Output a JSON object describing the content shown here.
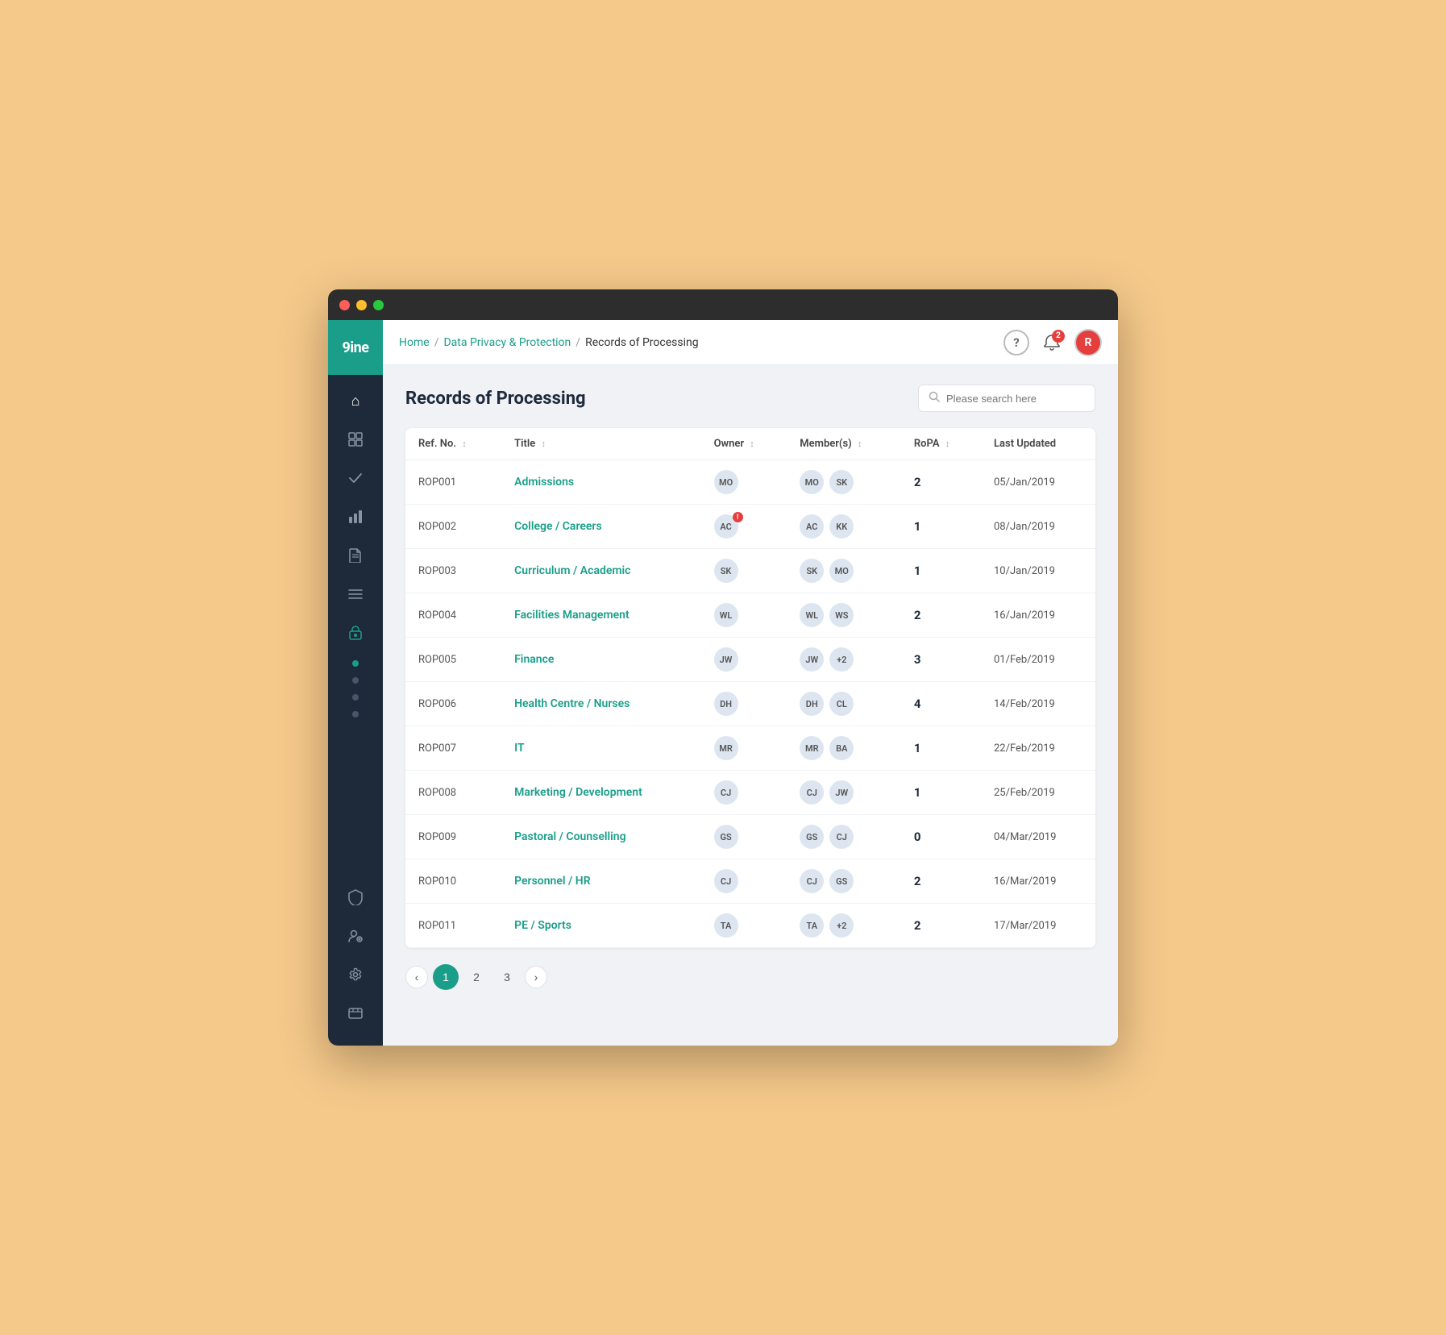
{
  "window": {
    "title": "Records of Processing"
  },
  "topnav": {
    "breadcrumb": {
      "home": "Home",
      "section": "Data Privacy & Protection",
      "current": "Records of Processing"
    },
    "notification_count": "2",
    "avatar_initials": "R"
  },
  "page": {
    "title": "Records of Processing",
    "search_placeholder": "Please search here"
  },
  "table": {
    "columns": [
      "Ref. No.",
      "Title",
      "Owner",
      "Member(s)",
      "RoPA",
      "Last Updated"
    ],
    "rows": [
      {
        "ref": "ROP001",
        "title": "Admissions",
        "owner": "MO",
        "members": [
          "MO",
          "SK"
        ],
        "extra_members": null,
        "ropa": "2",
        "date": "05/Jan/2019",
        "owner_warn": false
      },
      {
        "ref": "ROP002",
        "title": "College / Careers",
        "owner": "AC",
        "members": [
          "AC",
          "KK"
        ],
        "extra_members": null,
        "ropa": "1",
        "date": "08/Jan/2019",
        "owner_warn": true
      },
      {
        "ref": "ROP003",
        "title": "Curriculum / Academic",
        "owner": "SK",
        "members": [
          "SK",
          "MO"
        ],
        "extra_members": null,
        "ropa": "1",
        "date": "10/Jan/2019",
        "owner_warn": false
      },
      {
        "ref": "ROP004",
        "title": "Facilities Management",
        "owner": "WL",
        "members": [
          "WL",
          "WS"
        ],
        "extra_members": null,
        "ropa": "2",
        "date": "16/Jan/2019",
        "owner_warn": false
      },
      {
        "ref": "ROP005",
        "title": "Finance",
        "owner": "JW",
        "members": [
          "JW"
        ],
        "extra_members": "+2",
        "ropa": "3",
        "date": "01/Feb/2019",
        "owner_warn": false
      },
      {
        "ref": "ROP006",
        "title": "Health Centre / Nurses",
        "owner": "DH",
        "members": [
          "DH",
          "CL"
        ],
        "extra_members": null,
        "ropa": "4",
        "date": "14/Feb/2019",
        "owner_warn": false
      },
      {
        "ref": "ROP007",
        "title": "IT",
        "owner": "MR",
        "members": [
          "MR",
          "BA"
        ],
        "extra_members": null,
        "ropa": "1",
        "date": "22/Feb/2019",
        "owner_warn": false
      },
      {
        "ref": "ROP008",
        "title": "Marketing / Development",
        "owner": "CJ",
        "members": [
          "CJ",
          "JW"
        ],
        "extra_members": null,
        "ropa": "1",
        "date": "25/Feb/2019",
        "owner_warn": false
      },
      {
        "ref": "ROP009",
        "title": "Pastoral / Counselling",
        "owner": "GS",
        "members": [
          "GS",
          "CJ"
        ],
        "extra_members": null,
        "ropa": "0",
        "date": "04/Mar/2019",
        "owner_warn": false
      },
      {
        "ref": "ROP010",
        "title": "Personnel / HR",
        "owner": "CJ",
        "members": [
          "CJ",
          "GS"
        ],
        "extra_members": null,
        "ropa": "2",
        "date": "16/Mar/2019",
        "owner_warn": false
      },
      {
        "ref": "ROP011",
        "title": "PE / Sports",
        "owner": "TA",
        "members": [
          "TA"
        ],
        "extra_members": "+2",
        "ropa": "2",
        "date": "17/Mar/2019",
        "owner_warn": false
      }
    ]
  },
  "pagination": {
    "prev_label": "‹",
    "next_label": "›",
    "pages": [
      "1",
      "2",
      "3"
    ],
    "active_page": "1"
  },
  "sidebar": {
    "logo": "9ine",
    "icons": [
      {
        "name": "home-icon",
        "symbol": "⌂"
      },
      {
        "name": "dashboard-icon",
        "symbol": "⊞"
      },
      {
        "name": "tasks-icon",
        "symbol": "✓"
      },
      {
        "name": "analytics-icon",
        "symbol": "⬕"
      },
      {
        "name": "documents-icon",
        "symbol": "✎"
      },
      {
        "name": "list-icon",
        "symbol": "☰"
      },
      {
        "name": "privacy-icon",
        "symbol": "🔒"
      },
      {
        "name": "shield-icon",
        "symbol": "⛨"
      },
      {
        "name": "users-icon",
        "symbol": "👤"
      },
      {
        "name": "settings-icon",
        "symbol": "⚙"
      },
      {
        "name": "support-icon",
        "symbol": "⊡"
      }
    ]
  },
  "colors": {
    "accent": "#1a9e8a",
    "sidebar_bg": "#1e2a3a",
    "danger": "#e53e3e"
  }
}
